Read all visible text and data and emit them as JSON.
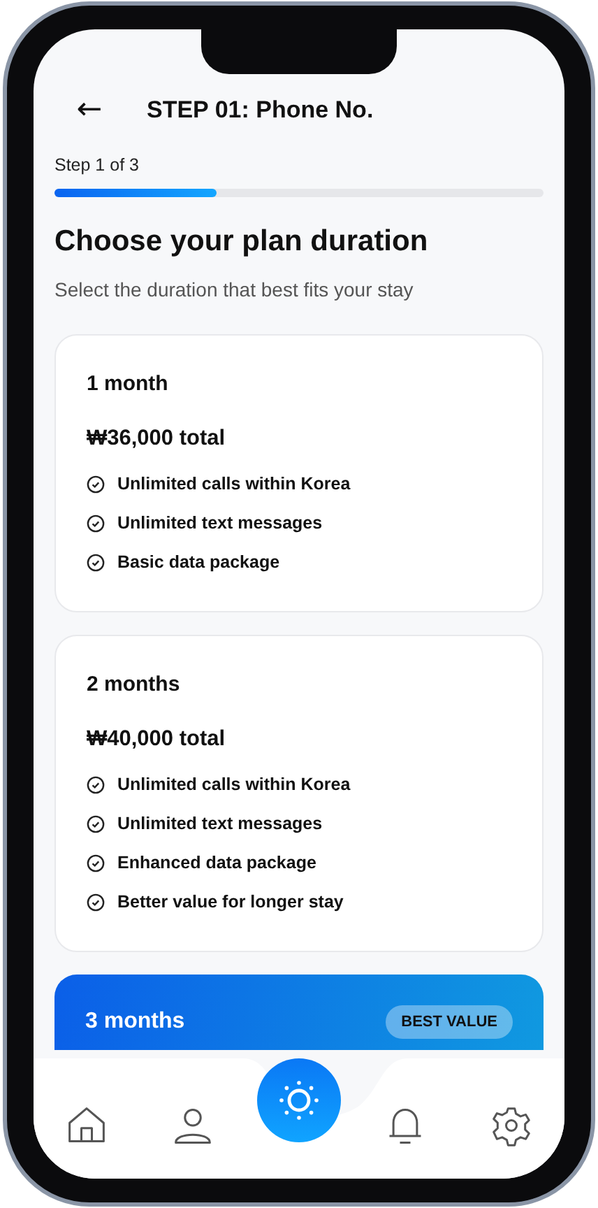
{
  "header": {
    "back": "←",
    "title": "STEP 01: Phone No."
  },
  "progress": {
    "label": "Step 1 of 3",
    "level": 0.33
  },
  "heading": "Choose your plan duration",
  "subtitle": "Select the duration that best fits your stay",
  "plans": [
    {
      "duration": "1  month",
      "price": "₩36,000  total",
      "highlighted": false,
      "features": [
        "Unlimited calls within Korea",
        "Unlimited text messages",
        "Basic data package"
      ]
    },
    {
      "duration": "2  months",
      "price": "₩40,000  total",
      "highlighted": false,
      "features": [
        "Unlimited calls within Korea",
        "Unlimited text messages",
        "Enhanced data package",
        "Better value for longer stay"
      ]
    },
    {
      "duration": "3  months",
      "badge": "BEST VALUE",
      "highlighted": true
    }
  ],
  "nav": [
    {
      "kind": "home"
    },
    {
      "kind": "profile"
    },
    {
      "kind": "center"
    },
    {
      "kind": "bell"
    },
    {
      "kind": "settings"
    }
  ]
}
